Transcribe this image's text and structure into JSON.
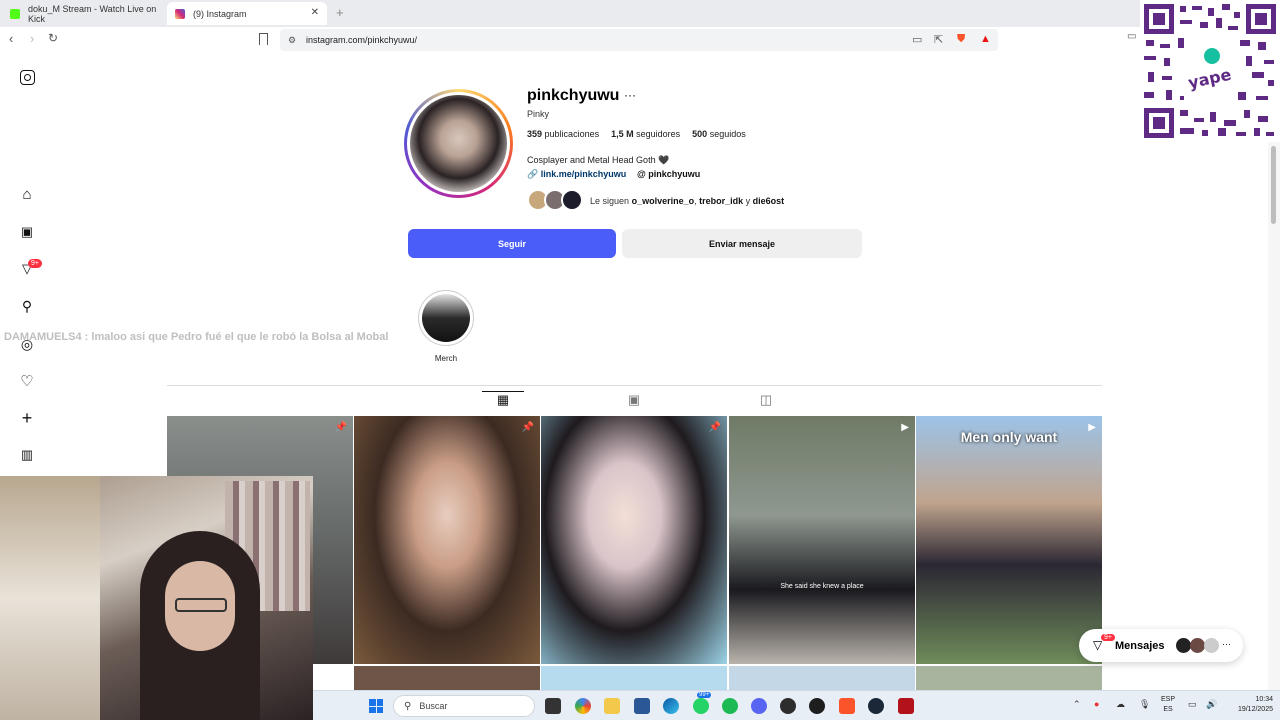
{
  "browser": {
    "tabs": [
      {
        "label": "doku_M Stream - Watch Live on Kick",
        "favicon_color": "#53fc18"
      },
      {
        "label": "(9) Instagram",
        "favicon_color": "#d62976"
      }
    ],
    "url": "instagram.com/pinkchyuwu/"
  },
  "rail": {
    "notifications_badge": "9+"
  },
  "chat_overlay": "DAMAMUELS4 : lmaloo asi que Pedro fué el que le robó la Bolsa al Mobal",
  "profile": {
    "username": "pinkchyuwu",
    "more": "···",
    "full_name": "Pinky",
    "stats": {
      "posts_count": "359",
      "posts_label": "publicaciones",
      "followers_count": "1,5 M",
      "followers_label": "seguidores",
      "following_count": "500",
      "following_label": "seguidos"
    },
    "bio": "Cosplayer and Metal Head Goth 🖤",
    "link": "link.me/pinkchyuwu",
    "threads_handle": "pinkchyuwu",
    "followed_by": {
      "prefix": "Le siguen",
      "user1": "o_wolverine_o",
      "user2": "trebor_idk",
      "joiner": "y",
      "user3": "die6ost"
    },
    "follow_button": "Seguir",
    "message_button": "Enviar mensaje",
    "highlight_label": "Merch"
  },
  "posts": [
    {
      "type": "pinned"
    },
    {
      "type": "pinned"
    },
    {
      "type": "pinned"
    },
    {
      "type": "reel",
      "caption": "She said she knew a place"
    },
    {
      "type": "reel",
      "caption": "Men only want"
    }
  ],
  "messages": {
    "label": "Mensajes",
    "badge": "9+",
    "more": "···"
  },
  "taskbar": {
    "search_placeholder": "Buscar",
    "whatsapp_badge": "99+",
    "lang_top": "ESP",
    "lang_bottom": "ES",
    "time": "10:34",
    "date": "19/12/2025"
  },
  "colors": {
    "follow_button": "#4a5df9",
    "accent_link": "#00376b",
    "badge": "#ff3040"
  }
}
